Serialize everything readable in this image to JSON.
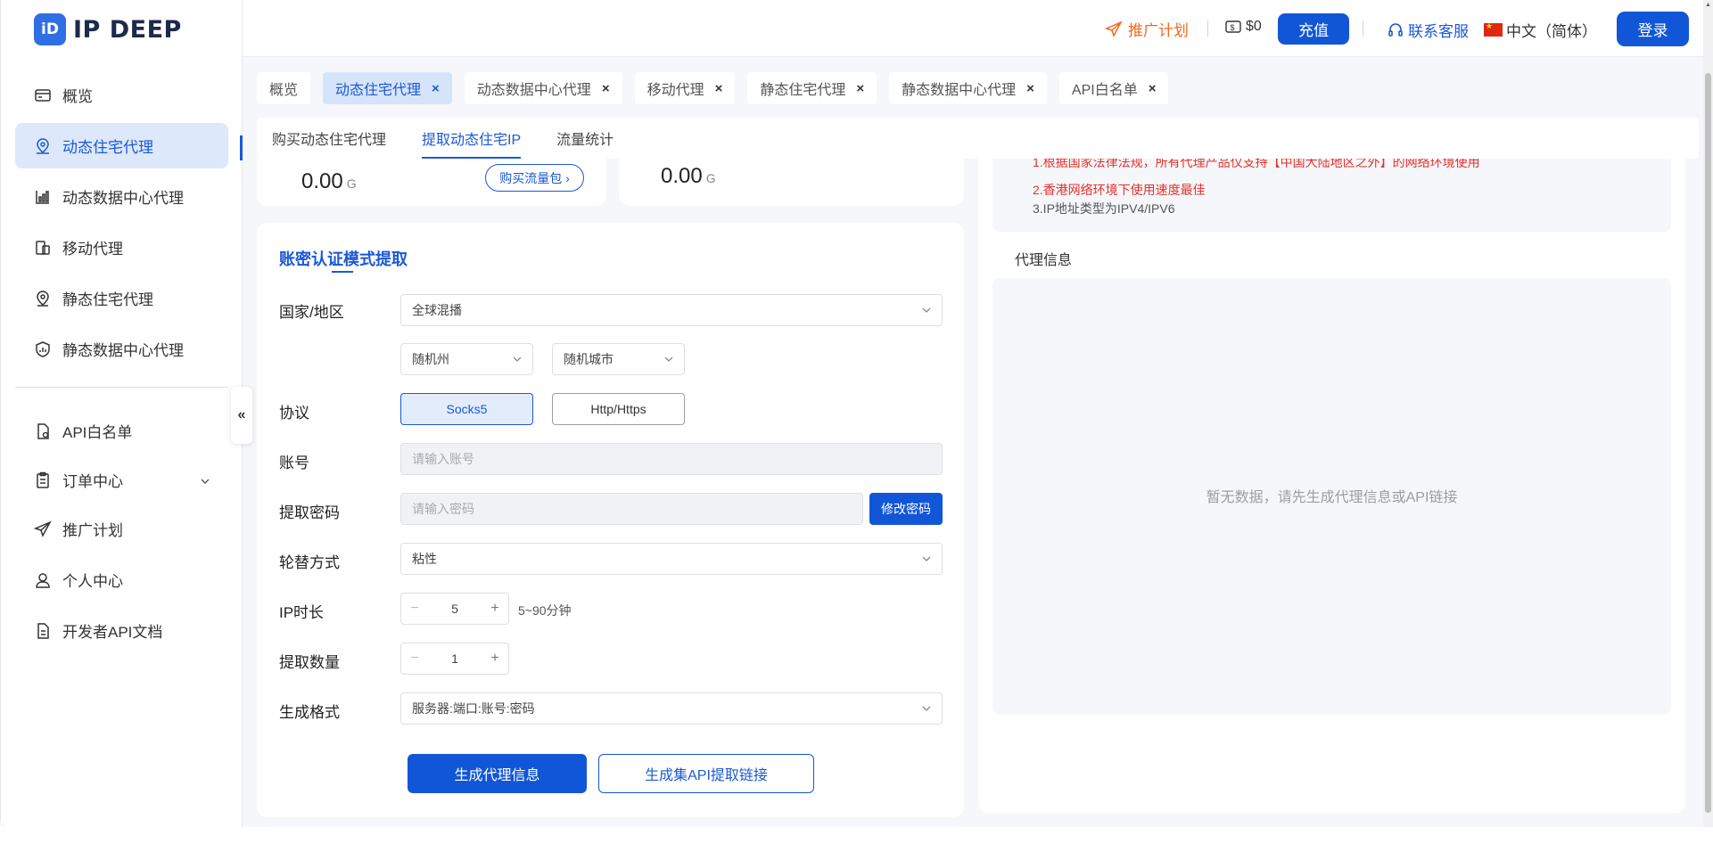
{
  "brand": {
    "name": "IP DEEP",
    "accent": "#1256d8"
  },
  "sidebar": {
    "items": [
      {
        "label": "概览",
        "icon": "overview-icon"
      },
      {
        "label": "动态住宅代理",
        "icon": "location-user-icon",
        "active": true
      },
      {
        "label": "动态数据中心代理",
        "icon": "chart-icon"
      },
      {
        "label": "移动代理",
        "icon": "mobile-icon"
      },
      {
        "label": "静态住宅代理",
        "icon": "pin-icon"
      },
      {
        "label": "静态数据中心代理",
        "icon": "shield-icon"
      },
      {
        "label": "API白名单",
        "icon": "doc-settings-icon"
      },
      {
        "label": "订单中心",
        "icon": "clipboard-icon"
      },
      {
        "label": "推广计划",
        "icon": "send-icon"
      },
      {
        "label": "个人中心",
        "icon": "user-icon"
      },
      {
        "label": "开发者API文档",
        "icon": "document-icon"
      }
    ],
    "collapse": "«"
  },
  "header": {
    "promo": "推广计划",
    "balance": "$0",
    "recharge": "充值",
    "service": "联系客服",
    "language": "中文（简体）",
    "login": "登录"
  },
  "tabs": [
    {
      "label": "概览"
    },
    {
      "label": "动态住宅代理",
      "active": true
    },
    {
      "label": "动态数据中心代理"
    },
    {
      "label": "移动代理"
    },
    {
      "label": "静态住宅代理"
    },
    {
      "label": "静态数据中心代理"
    },
    {
      "label": "API白名单"
    }
  ],
  "subtabs": [
    {
      "label": "购买动态住宅代理"
    },
    {
      "label": "提取动态住宅IP",
      "active": true
    },
    {
      "label": "流量统计"
    }
  ],
  "stats": {
    "left_value": "0.00",
    "left_unit": "G",
    "buy_package": "购买流量包",
    "right_value": "0.00",
    "right_unit": "G"
  },
  "form": {
    "title": "账密认证模式提取",
    "country_label": "国家/地区",
    "country_value": "全球混播",
    "state_value": "随机州",
    "city_value": "随机城市",
    "protocol_label": "协议",
    "protocol_socks": "Socks5",
    "protocol_http": "Http/Https",
    "account_label": "账号",
    "account_placeholder": "请输入账号",
    "password_label": "提取密码",
    "password_placeholder": "请输入密码",
    "change_password": "修改密码",
    "rotation_label": "轮替方式",
    "rotation_value": "粘性",
    "duration_label": "IP时长",
    "duration_value": "5",
    "duration_hint": "5~90分钟",
    "count_label": "提取数量",
    "count_value": "1",
    "format_label": "生成格式",
    "format_value": "服务器:端口:账号:密码",
    "generate": "生成代理信息",
    "generate_api": "生成集API提取链接"
  },
  "notes": {
    "line1": "1.根据国家法律法规，所有代理产品仅支持【中国大陆地区之外】的网络环境使用",
    "line2": "2.香港网络环境下使用速度最佳",
    "line3": "3.IP地址类型为IPV4/IPV6"
  },
  "proxy": {
    "title": "代理信息",
    "empty": "暂无数据，请先生成代理信息或API链接"
  }
}
